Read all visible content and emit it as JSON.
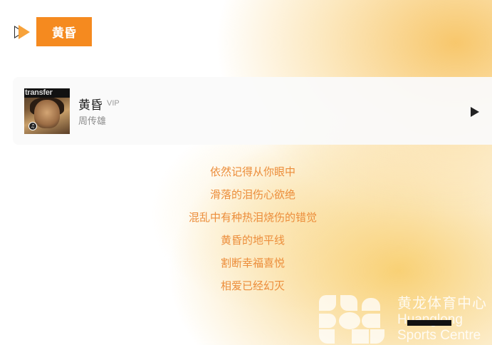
{
  "header": {
    "tag_label": "黄昏"
  },
  "song": {
    "title": "黄昏",
    "vip_label": "VIP",
    "artist": "周传雄",
    "album_text": "transfer",
    "play_icon": "play-icon"
  },
  "lyrics": [
    "依然记得从你眼中",
    "滑落的泪伤心欲绝",
    "混乱中有种热泪烧伤的错觉",
    "黄昏的地平线",
    "割断幸福喜悦",
    "相爱已经幻灭"
  ],
  "watermark": {
    "cn": "黄龙体育中心",
    "en_line1": "Huanglong",
    "en_line2": "Sports Centre"
  },
  "colors": {
    "accent": "#f58a1f",
    "lyric": "#ec8d3a"
  }
}
